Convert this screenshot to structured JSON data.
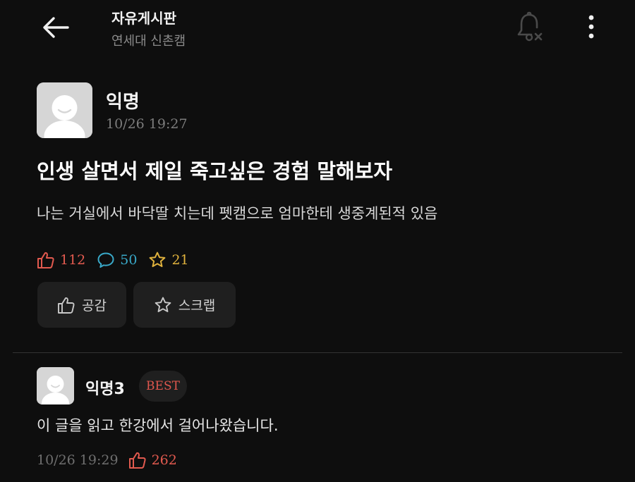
{
  "header": {
    "title": "자유게시판",
    "subtitle": "연세대 신촌캠",
    "back_icon": "arrow-left-icon",
    "notification_icon": "bell-off-icon",
    "more_icon": "more-vertical-icon"
  },
  "post": {
    "author": "익명",
    "time": "10/26 19:27",
    "title": "인생 살면서 제일 죽고싶은 경험 말해보자",
    "body": "나는 거실에서 바닥딸 치는데 펫캠으로 엄마한테 생중계된적 있음",
    "stats": {
      "likes": "112",
      "comments": "50",
      "scraps": "21"
    },
    "actions": {
      "like_label": "공감",
      "scrap_label": "스크랩"
    }
  },
  "comments": [
    {
      "author": "익명3",
      "badge": "BEST",
      "body": "이 글을 읽고 한강에서 걸어나왔습니다.",
      "time": "10/26 19:29",
      "likes": "262"
    }
  ],
  "colors": {
    "background": "#0e0e0e",
    "like": "#e25a4f",
    "comment": "#39a9c9",
    "scrap": "#e0b23d",
    "button_bg": "#1f1f1f"
  }
}
